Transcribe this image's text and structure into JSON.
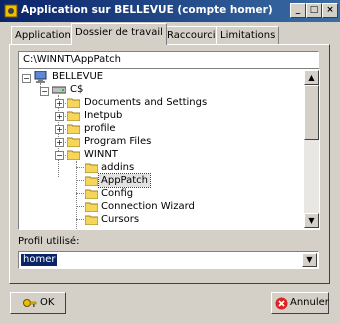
{
  "window": {
    "title": "Application sur BELLEVUE (compte homer)",
    "controls": {
      "minimize": "_",
      "maximize": "□",
      "close": "×"
    }
  },
  "tabs": [
    {
      "label": "Application",
      "active": false
    },
    {
      "label": "Dossier de travail",
      "active": true
    },
    {
      "label": "Raccourci",
      "active": false
    },
    {
      "label": "Limitations",
      "active": false
    }
  ],
  "path_field": {
    "value": "C:\\WINNT\\AppPatch"
  },
  "tree": {
    "root": "BELLEVUE",
    "drive": "C$",
    "folders": [
      "Documents and Settings",
      "Inetpub",
      "profile",
      "Program Files",
      "WINNT"
    ],
    "winnt_children": [
      "addins",
      "AppPatch",
      "Config",
      "Connection Wizard",
      "Cursors"
    ],
    "selected": "AppPatch",
    "expand_signs": {
      "expanded": "−",
      "collapsed": "+"
    }
  },
  "profile": {
    "label": "Profil utilisé:",
    "value": "homer"
  },
  "buttons": {
    "ok": "OK",
    "cancel": "Annuler"
  },
  "colors": {
    "title_start": "#0a246a",
    "title_end": "#3a6ea5",
    "selection": "#0a246a",
    "face": "#d4d0c8",
    "folder": "#f5d65a",
    "cancel_icon": "#d22"
  },
  "icons": {
    "app": "app-icon",
    "computer": "computer-icon",
    "drive": "drive-icon",
    "folder": "folder-icon",
    "ok": "ok-key-icon",
    "cancel": "cancel-x-icon"
  }
}
